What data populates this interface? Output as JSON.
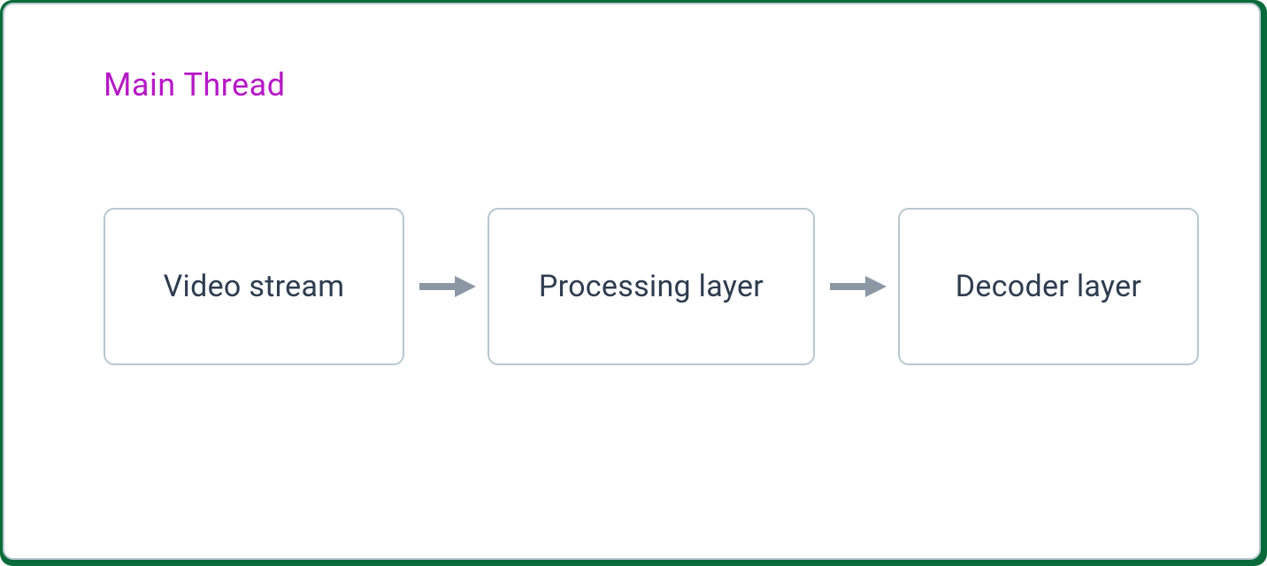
{
  "title": "Main Thread",
  "nodes": {
    "video_stream": "Video stream",
    "processing_layer": "Processing layer",
    "decoder_layer": "Decoder layer"
  },
  "colors": {
    "title": "#b519c6",
    "node_text": "#2e3c4f",
    "border": "#b7c8d0",
    "arrow": "#8b98a4",
    "outer_shadow": "#0a6b3a"
  }
}
